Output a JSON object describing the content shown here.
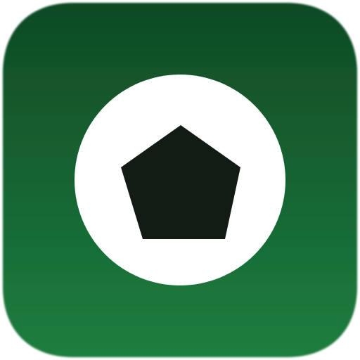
{
  "app_icon": {
    "icon_name": "soccer-ball-pentagon-icon",
    "colors": {
      "background_top": "#0f4a24",
      "background_bottom": "#1d7e3f",
      "circle": "#ffffff",
      "pentagon": "#121c15"
    }
  }
}
